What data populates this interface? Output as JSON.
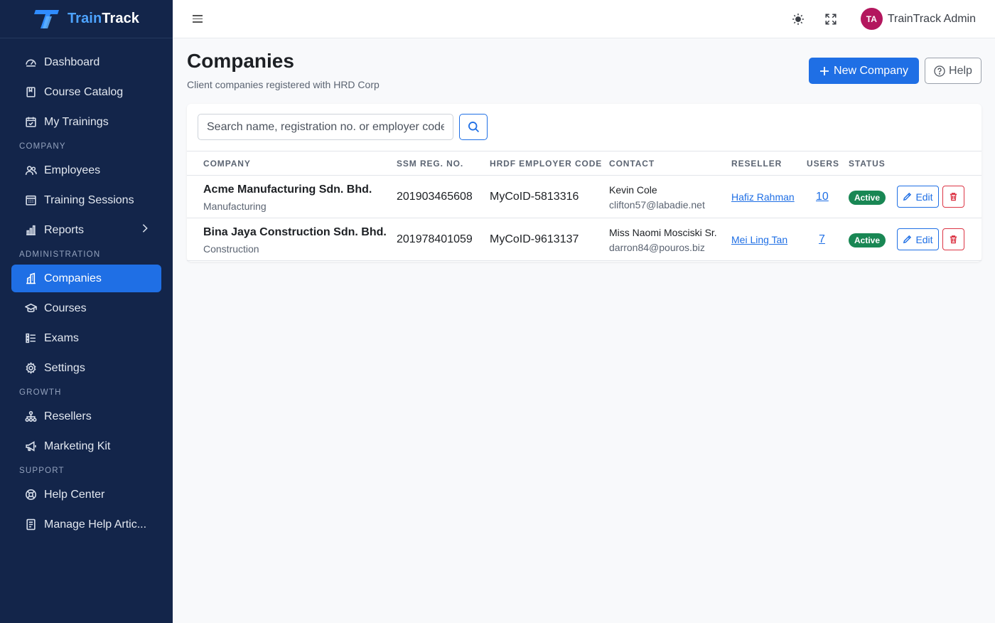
{
  "brand": {
    "name_part1": "Train",
    "name_part2": "Track"
  },
  "sidebar": {
    "items_top": [
      {
        "label": "Dashboard",
        "icon": "dashboard-icon"
      },
      {
        "label": "Course Catalog",
        "icon": "book-icon"
      },
      {
        "label": "My Trainings",
        "icon": "calendar-check-icon"
      }
    ],
    "section_company": "COMPANY",
    "items_company": [
      {
        "label": "Employees",
        "icon": "people-icon"
      },
      {
        "label": "Training Sessions",
        "icon": "calendar-grid-icon"
      },
      {
        "label": "Reports",
        "icon": "bar-chart-icon"
      }
    ],
    "section_admin": "ADMINISTRATION",
    "items_admin": [
      {
        "label": "Companies",
        "icon": "building-icon",
        "active": true
      },
      {
        "label": "Courses",
        "icon": "mortarboard-icon"
      },
      {
        "label": "Exams",
        "icon": "checklist-icon"
      },
      {
        "label": "Settings",
        "icon": "gear-icon"
      }
    ],
    "section_growth": "GROWTH",
    "items_growth": [
      {
        "label": "Resellers",
        "icon": "diagram-icon"
      },
      {
        "label": "Marketing Kit",
        "icon": "megaphone-icon"
      }
    ],
    "section_support": "SUPPORT",
    "items_support": [
      {
        "label": "Help Center",
        "icon": "life-ring-icon"
      },
      {
        "label": "Manage Help Artic...",
        "icon": "document-icon"
      }
    ]
  },
  "topbar": {
    "user_initials": "TA",
    "user_name": "TrainTrack Admin"
  },
  "page": {
    "title": "Companies",
    "subtitle": "Client companies registered with HRD Corp",
    "new_button": "New Company",
    "help_button": "Help"
  },
  "search": {
    "placeholder": "Search name, registration no. or employer code"
  },
  "table": {
    "headers": [
      "COMPANY",
      "SSM REG. NO.",
      "HRDF EMPLOYER CODE",
      "CONTACT",
      "RESELLER",
      "USERS",
      "STATUS"
    ],
    "rows": [
      {
        "name": "Acme Manufacturing Sdn. Bhd.",
        "industry": "Manufacturing",
        "ssm": "201903465608",
        "hrdf": "MyCoID-5813316",
        "contact_name": "Kevin Cole",
        "contact_email": "clifton57@labadie.net",
        "reseller": "Hafiz Rahman",
        "users": "10",
        "status": "Active"
      },
      {
        "name": "Bina Jaya Construction Sdn. Bhd.",
        "industry": "Construction",
        "ssm": "201978401059",
        "hrdf": "MyCoID-9613137",
        "contact_name": "Miss Naomi Mosciski Sr.",
        "contact_email": "darron84@pouros.biz",
        "reseller": "Mei Ling Tan",
        "users": "7",
        "status": "Active"
      }
    ],
    "edit_label": "Edit"
  },
  "colors": {
    "sidebar_bg": "#13254a",
    "accent": "#1f6fe5",
    "active_badge": "#198754",
    "danger": "#dc3545",
    "avatar": "#b3175e"
  }
}
